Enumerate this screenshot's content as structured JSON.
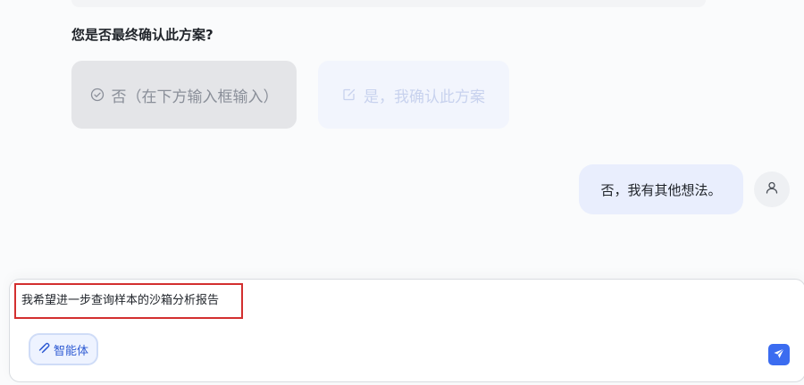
{
  "question": "您是否最终确认此方案?",
  "options": {
    "no_label": "否（在下方输入框输入）",
    "yes_label": "是，我确认此方案",
    "no_icon": "check-circle-icon",
    "yes_icon": "edit-icon"
  },
  "chat": {
    "user_message": "否，我有其他想法。",
    "avatar_icon": "user-icon"
  },
  "composer": {
    "input_value": "我希望进一步查询样本的沙箱分析报告",
    "agent_label": "智能体",
    "agent_icon": "agent-icon",
    "send_icon": "send-icon"
  },
  "colors": {
    "accent": "#3b6cf0",
    "highlight_border": "#d32f2f",
    "bubble_bg": "#e9eefd"
  }
}
